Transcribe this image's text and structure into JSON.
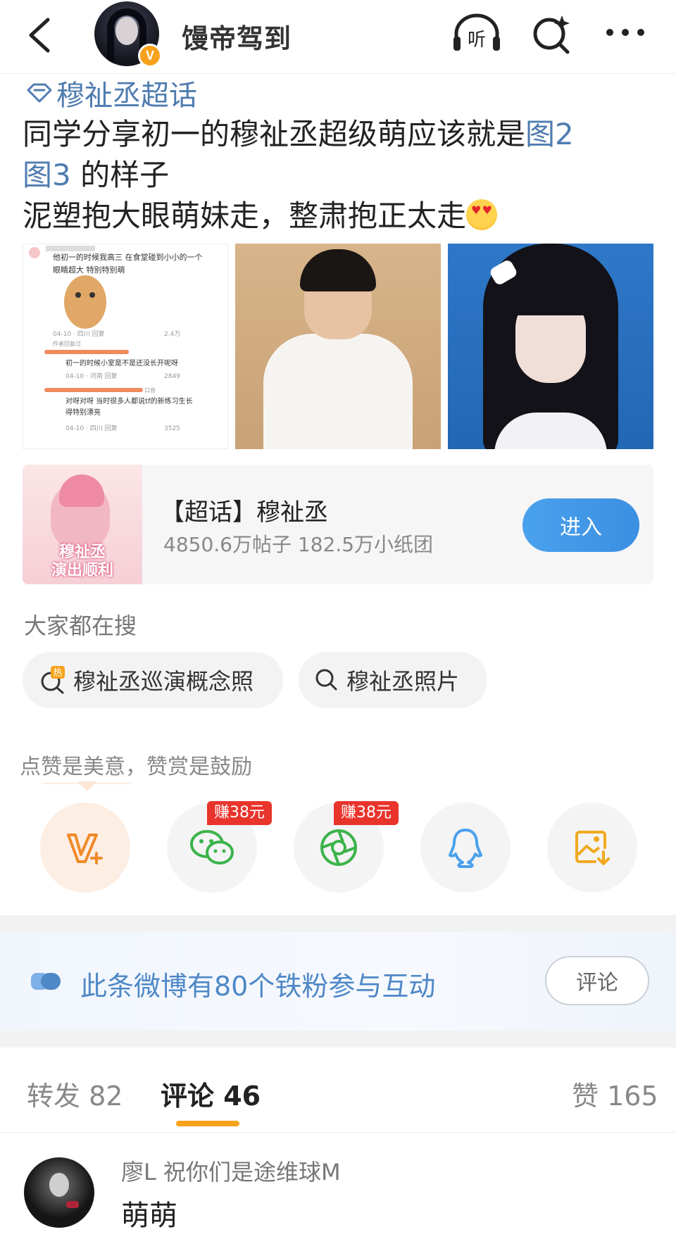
{
  "header": {
    "username": "馒帝驾到",
    "verified_badge": "V",
    "icons": [
      "back-arrow-icon",
      "listen-icon",
      "search-sparkle-icon",
      "more-icon"
    ],
    "listen_label": "听"
  },
  "post": {
    "topic_tag": "穆祉丞超话",
    "line1_text": "同学分享初一的穆祉丞超级萌应该就是",
    "line1_link": "图2",
    "line2_link": "图3",
    "line2_text": " 的样子",
    "line3_text": "泥塑抱大眼萌妹走，整肃抱正太走",
    "emoji": "heart-eyes-emoji",
    "images": [
      {
        "name": "screenshot-comments",
        "texts": [
          "他初一的时候我高三 在食堂碰到小小的一个",
          "眼睛超大 特别特别萌",
          "04-10 · 四川    回复",
          "2.4万",
          "作者回复过",
          "初一的时候小室是不是还没长开呢呀",
          "04-10 · 河南    回复",
          "2849",
          "口音",
          "对呀对呀 当时很多人都说tf的新练习生长",
          "得特别漂亮",
          "04-10 · 四川    回复",
          "3525"
        ]
      },
      {
        "name": "boy-photo"
      },
      {
        "name": "girl-photo"
      }
    ]
  },
  "super_topic_card": {
    "thumb_caption": "穆祉丞\n演出顺利",
    "title": "【超话】穆祉丞",
    "stats": "4850.6万帖子 182.5万小纸团",
    "enter_label": "进入"
  },
  "search_hints": {
    "title": "大家都在搜",
    "hot_badge": "热",
    "items": [
      "穆祉丞巡演概念照",
      "穆祉丞照片"
    ]
  },
  "share": {
    "praise_text": "点赞是美意，赞赏是鼓励",
    "earn_badge_wechat": "赚38元",
    "earn_badge_moments": "赚38元",
    "buttons": [
      "v-plus-icon",
      "wechat-icon",
      "moments-icon",
      "qq-icon",
      "save-image-icon"
    ]
  },
  "fans_bar": {
    "text": "此条微博有80个铁粉参与互动",
    "comment_label": "评论"
  },
  "tabs": {
    "repost": "转发 82",
    "comment": "评论 46",
    "like": "赞 165"
  },
  "comment": {
    "user": "廖L 祝你们是途维球M",
    "text": "萌萌"
  },
  "colors": {
    "link_blue": "#4f7cb0",
    "accent_orange": "#f7a21a",
    "enter_blue": "#3b8fe3",
    "earn_red": "#e9342c"
  }
}
